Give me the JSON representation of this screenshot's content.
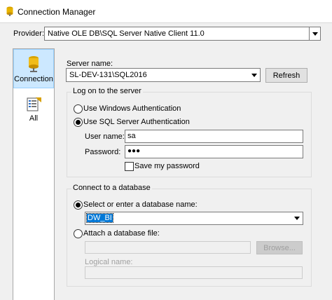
{
  "window": {
    "title": "Connection Manager"
  },
  "provider": {
    "label": "Provider:",
    "value": "Native OLE DB\\SQL Server Native Client 11.0"
  },
  "nav": [
    {
      "label": "Connection"
    },
    {
      "label": "All"
    }
  ],
  "server": {
    "label": "Server name:",
    "value": "SL-DEV-131\\SQL2016",
    "refresh_label": "Refresh"
  },
  "logon": {
    "group_title": "Log on to the server",
    "windows_auth_label": "Use Windows Authentication",
    "sql_auth_label": "Use SQL Server Authentication",
    "username_label": "User name:",
    "username_value": "sa",
    "password_label": "Password:",
    "password_value": "●●●",
    "save_password_label": "Save my password"
  },
  "database": {
    "group_title": "Connect to a database",
    "select_label": "Select or enter a database name:",
    "db_value": "DW_BI",
    "attach_label": "Attach a database file:",
    "browse_label": "Browse...",
    "logical_name_label": "Logical name:"
  }
}
